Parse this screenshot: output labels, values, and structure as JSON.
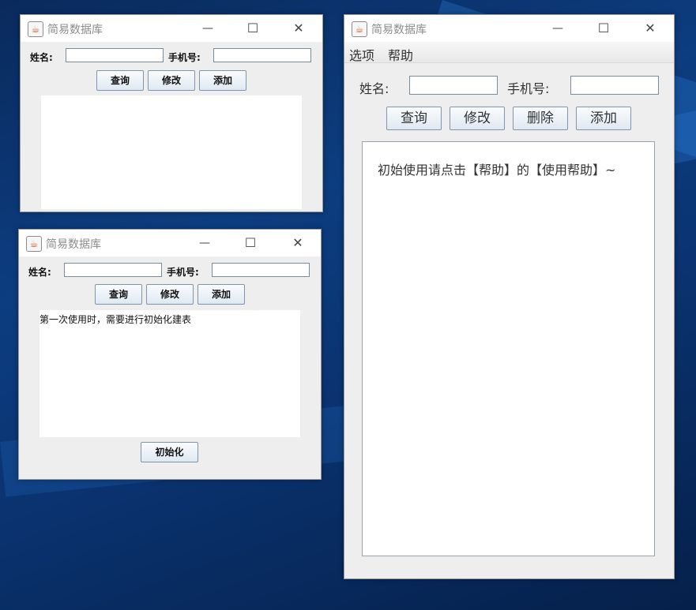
{
  "desktop": {
    "accent": "#0c3d80"
  },
  "window_small_top": {
    "title": "简易数据库",
    "name_label": "姓名:",
    "name_value": "",
    "phone_label": "手机号:",
    "phone_value": "",
    "buttons": [
      "查询",
      "修改",
      "添加"
    ],
    "output_text": ""
  },
  "window_small_bottom": {
    "title": "简易数据库",
    "name_label": "姓名:",
    "name_value": "",
    "phone_label": "手机号:",
    "phone_value": "",
    "buttons": [
      "查询",
      "修改",
      "添加"
    ],
    "output_text": "第一次使用时，需要进行初始化建表",
    "init_button": "初始化"
  },
  "window_large": {
    "title": "简易数据库",
    "menu": [
      "选项",
      "帮助"
    ],
    "name_label": "姓名:",
    "name_value": "",
    "phone_label": "手机号:",
    "phone_value": "",
    "buttons": [
      "查询",
      "修改",
      "删除",
      "添加"
    ],
    "output_text": "初始使用请点击【帮助】的【使用帮助】~"
  },
  "icons": {
    "app": "java-cup-icon",
    "minimize": "minimize-icon",
    "maximize": "maximize-icon",
    "close": "close-icon"
  }
}
